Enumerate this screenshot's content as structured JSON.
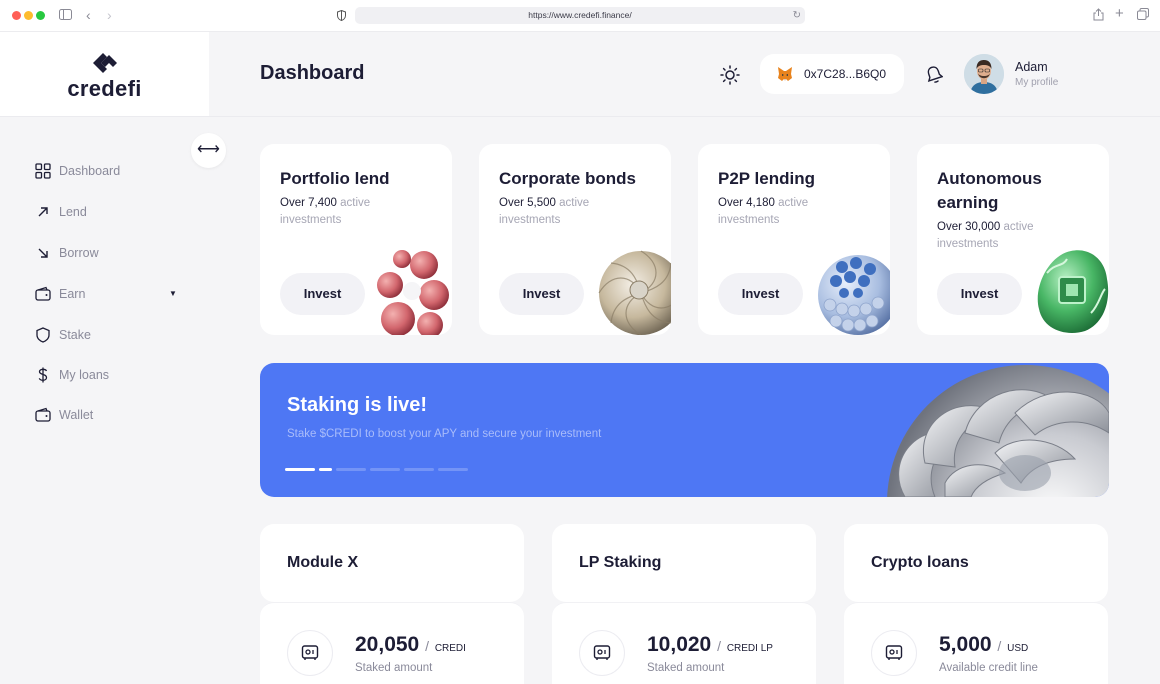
{
  "browser": {
    "url": "https://www.credefi.finance/"
  },
  "brand": {
    "name": "credefi"
  },
  "nav": [
    {
      "label": "Dashboard",
      "icon": "grid-icon"
    },
    {
      "label": "Lend",
      "icon": "arrow-up-right-icon"
    },
    {
      "label": "Borrow",
      "icon": "arrow-down-right-icon"
    },
    {
      "label": "Earn",
      "icon": "wallet-icon",
      "has_dropdown": true
    },
    {
      "label": "Stake",
      "icon": "shield-icon"
    },
    {
      "label": "My loans",
      "icon": "dollar-icon"
    },
    {
      "label": "Wallet",
      "icon": "wallet-icon"
    }
  ],
  "header": {
    "title": "Dashboard",
    "wallet_address": "0x7C28...B6Q0",
    "user_name": "Adam",
    "user_sub": "My profile"
  },
  "cards": [
    {
      "title": "Portfolio lend",
      "count": "Over 7,400",
      "count_suffix": " active investments",
      "button": "Invest",
      "art_color": "#d97a7f"
    },
    {
      "title": "Corporate bonds",
      "count": "Over 5,500",
      "count_suffix": " active investments",
      "button": "Invest",
      "art_color": "#cfc3ad"
    },
    {
      "title": "P2P lending",
      "count": "Over 4,180",
      "count_suffix": " active investments",
      "button": "Invest",
      "art_color": "#6e92d6"
    },
    {
      "title": "Autonomous earning",
      "count": "Over 30,000",
      "count_suffix": " active investments",
      "button": "Invest",
      "art_color": "#4fbf70"
    }
  ],
  "banner": {
    "title": "Staking is live!",
    "subtitle": "Stake $CREDI to boost your APY and secure your investment",
    "slides": 6,
    "active_slides": 2,
    "color": "#4e77f4"
  },
  "panels": [
    {
      "title": "Module X",
      "amount": "20,050",
      "unit": "CREDI",
      "label": "Staked amount"
    },
    {
      "title": "LP Staking",
      "amount": "10,020",
      "unit": "CREDI LP",
      "label": "Staked amount"
    },
    {
      "title": "Crypto loans",
      "amount": "5,000",
      "unit": "USD",
      "label": "Available credit line"
    }
  ]
}
